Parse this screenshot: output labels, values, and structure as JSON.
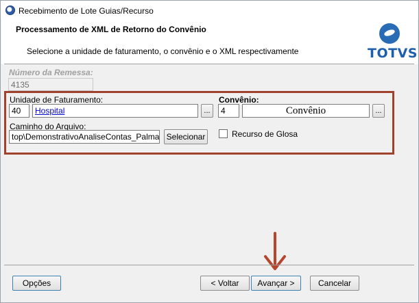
{
  "window": {
    "title": "Recebimento de Lote Guias/Recurso"
  },
  "header": {
    "title": "Processamento de XML de Retorno do Convênio",
    "subtitle": "Selecione a unidade de faturamento, o convênio e o XML respectivamente",
    "logo_text": "TOTVS"
  },
  "remessa": {
    "label": "Número da Remessa:",
    "value": "4135"
  },
  "unidade": {
    "label": "Unidade de Faturamento:",
    "code": "40",
    "name": "Hospital",
    "browse_label": "..."
  },
  "convenio": {
    "label": "Convênio:",
    "code": "4",
    "name": "Convênio",
    "browse_label": "..."
  },
  "arquivo": {
    "label": "Caminho do Arquivo:",
    "value": "top\\DemonstrativoAnaliseContas_Palmas.xml",
    "select_label": "Selecionar"
  },
  "glosa": {
    "label": "Recurso de Glosa",
    "checked": false
  },
  "footer": {
    "options_label": "Opções",
    "back_label": "< Voltar",
    "next_label": "Avançar >",
    "cancel_label": "Cancelar"
  },
  "colors": {
    "highlight": "#a0412d",
    "arrow": "#b5462d",
    "brand": "#1c5fae"
  }
}
